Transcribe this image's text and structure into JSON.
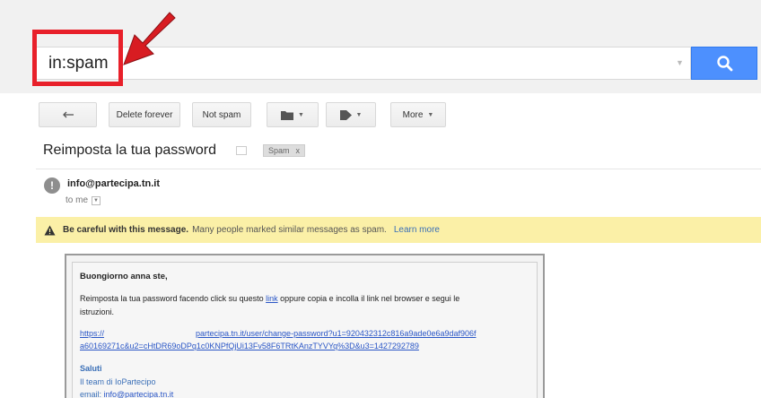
{
  "search": {
    "query": "in:spam"
  },
  "toolbar": {
    "delete_forever": "Delete forever",
    "not_spam": "Not spam",
    "more": "More"
  },
  "message": {
    "subject": "Reimposta la tua password",
    "label": "Spam",
    "label_close": "x",
    "avatar_letter": "!",
    "sender": "info@partecipa.tn.it",
    "to": "to me"
  },
  "warning": {
    "bold": "Be careful with this message.",
    "text": "Many people marked similar messages as spam.",
    "learn_more": "Learn more"
  },
  "body": {
    "greeting": "Buongiorno  anna ste,",
    "para_before_link": "Reimposta la tua password facendo click su questo ",
    "link_word": "link",
    "para_after_link": " oppure copia e incolla il link nel browser e segui le",
    "para_line2": "istruzioni.",
    "url_line1a": "https://",
    "url_line1b": "partecipa.tn.it/user/change-password?u1=920432312c816a9ade0e6a9daf906f",
    "url_line2": "a60169271c&u2=cHtDR69oDPq1c0KNPfQjUi13Fv58F6TRtKAnzTYVYq%3D&u3=1427292789",
    "saluti": "Saluti",
    "team": "Il team di IoPartecipo",
    "email_label": "email: ",
    "email_value": "info@partecipa.tn.it"
  },
  "colors": {
    "highlight": "#e8202a",
    "search_button": "#4d90fe",
    "warning_bg": "#fbf0a7",
    "link": "#3a6fb7"
  }
}
